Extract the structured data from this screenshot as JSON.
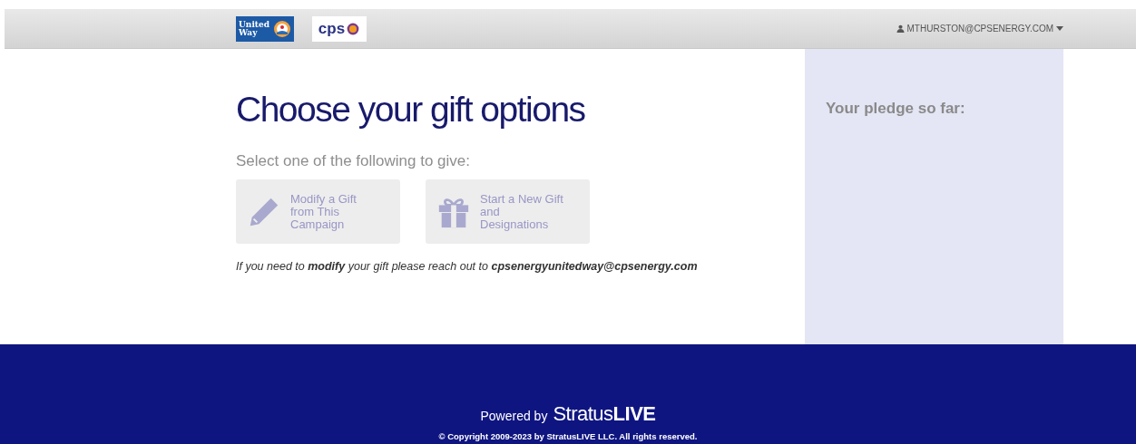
{
  "header": {
    "logos": [
      {
        "kind": "unitedway",
        "text": "United Way"
      },
      {
        "kind": "cps",
        "text": "cps"
      }
    ],
    "user": "MTHURSTON@CPSENERGY.COM"
  },
  "main": {
    "title": "Choose your gift options",
    "subtitle": "Select one of the following to give:",
    "options": [
      {
        "kind": "pencil",
        "label": "Modify a Gift from This Campaign"
      },
      {
        "kind": "gift",
        "label": "Start a New Gift and Designations"
      }
    ],
    "note": "If you need to **modify** your gift please reach out to **cpsenergyunitedway@cpsenergy.com**"
  },
  "sidebar": {
    "title": "Your pledge so far:"
  },
  "footer": {
    "powered": "Powered by",
    "brand_light": "Stratus",
    "brand_bold": "LIVE",
    "copyright": "© Copyright 2009-2023 by StratusLIVE LLC. All rights reserved."
  }
}
